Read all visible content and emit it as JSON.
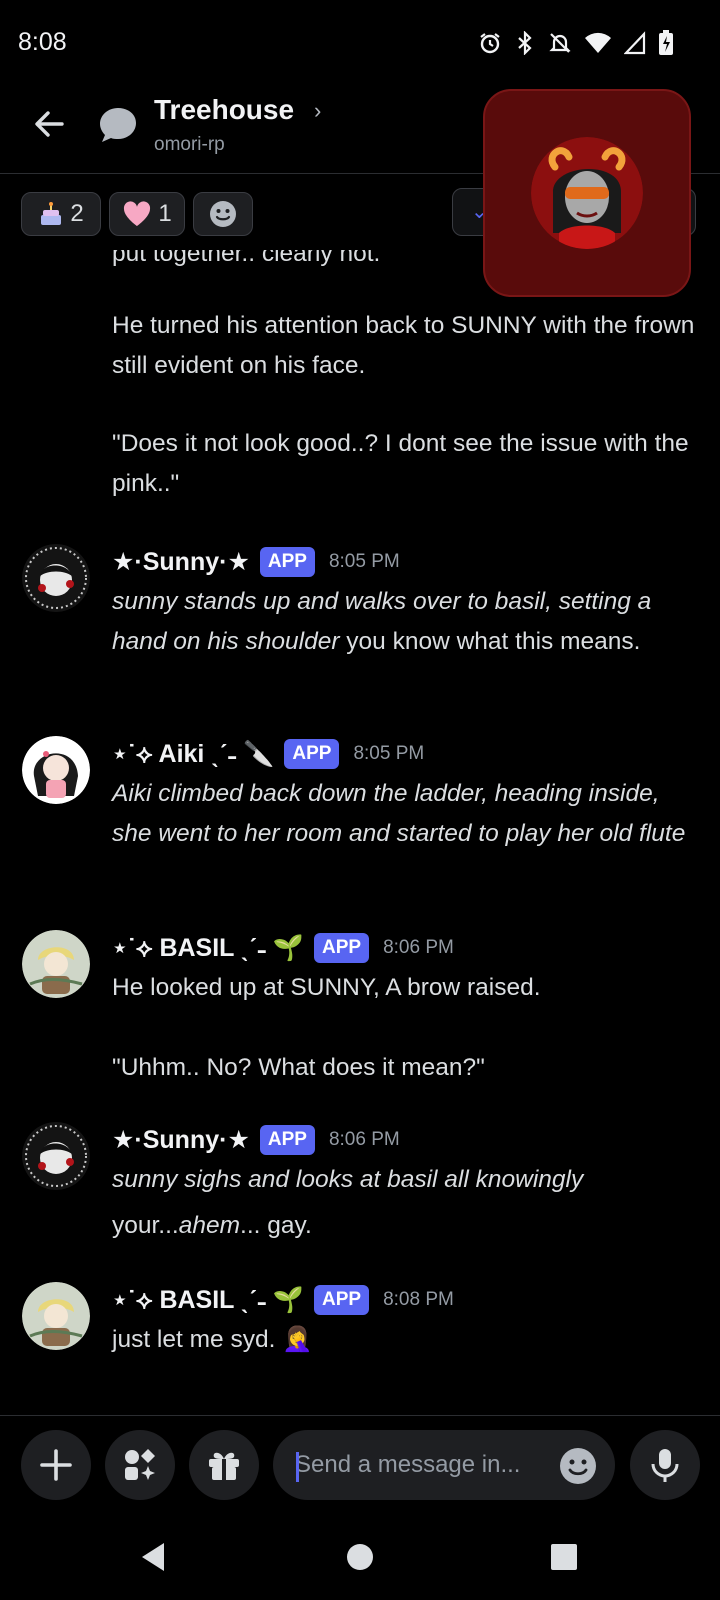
{
  "status_bar": {
    "time": "8:08"
  },
  "header": {
    "title": "Treehouse",
    "chevron": "›",
    "subtitle": "omori-rp"
  },
  "reactions": [
    {
      "emoji": "birthday-cake",
      "count": "2"
    },
    {
      "emoji": "pink-heart",
      "count": "1"
    }
  ],
  "messages": {
    "continued": {
      "clipped_line": "put together.. clearly not.",
      "p1": "He turned his attention back to SUNNY with the frown still evident on his face.",
      "p2": "\"Does it not look good..? I dont see the issue with the pink..\""
    },
    "m1": {
      "username": "★·Sunny·★",
      "badge": "APP",
      "time": "8:05 PM",
      "italic": "sunny stands up and walks over to basil, setting a hand on his shoulder",
      "plain": " you know what this means."
    },
    "m2": {
      "username": "⋆˙⟡ Aiki ˎˊ˗ 🔪",
      "badge": "APP",
      "time": "8:05 PM",
      "italic": "Aiki climbed back down the ladder, heading inside, she went to her room and started to play her old flute"
    },
    "m3": {
      "username": "⋆˙⟡ BASIL ˎˊ˗ 🌱",
      "badge": "APP",
      "time": "8:06 PM",
      "p1": "He looked up at SUNNY, A brow raised.",
      "p2": "\"Uhhm.. No? What does it mean?\""
    },
    "m4": {
      "username": "★·Sunny·★",
      "badge": "APP",
      "time": "8:06 PM",
      "italic": "sunny sighs and looks at basil all knowingly",
      "plain_a": "your...",
      "italic_b": "ahem",
      "plain_c": "... gay."
    },
    "m5": {
      "username": "⋆˙⟡ BASIL ˎˊ˗ 🌱",
      "badge": "APP",
      "time": "8:08 PM",
      "text": "just let me syd. 🤦‍♀️"
    }
  },
  "composer": {
    "placeholder": "Send a message in..."
  },
  "colors": {
    "accent": "#5865f2",
    "background": "#000000",
    "pip_background": "#590b0b"
  }
}
